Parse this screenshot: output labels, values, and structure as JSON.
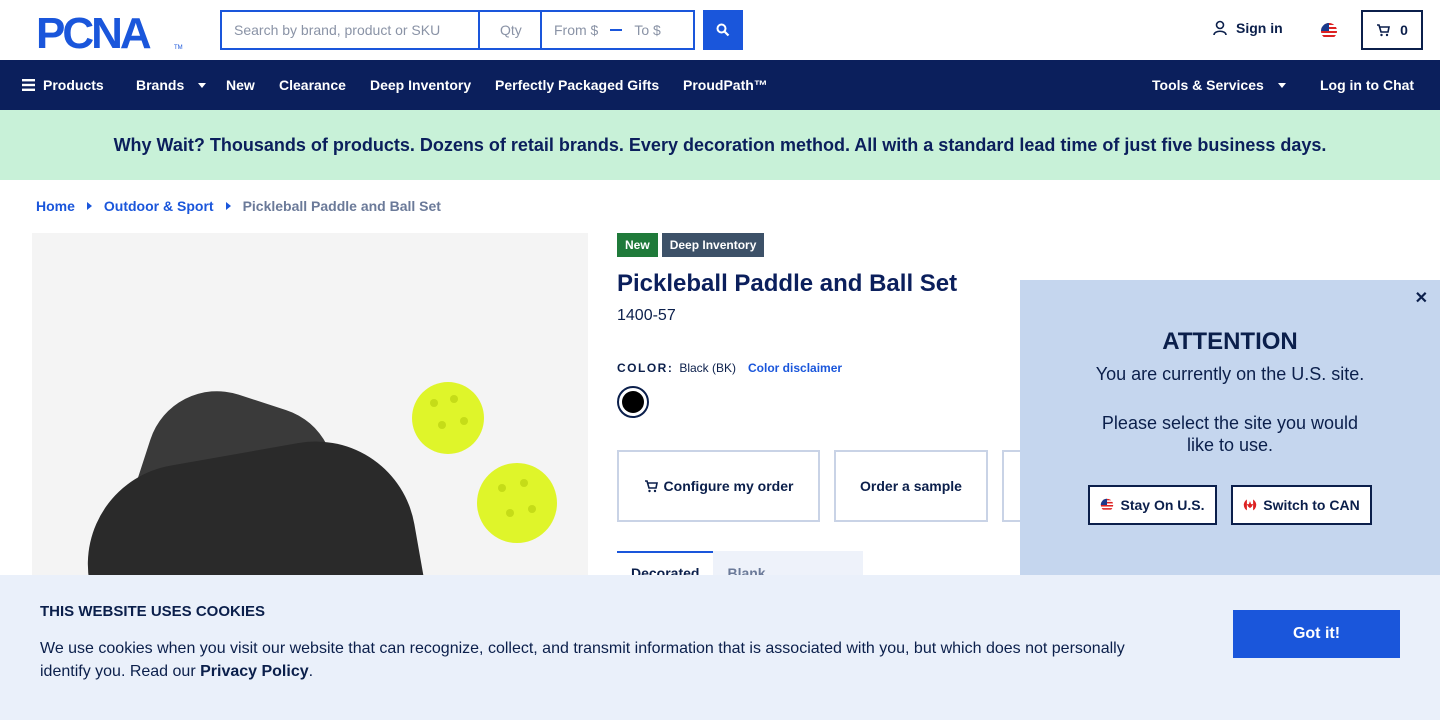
{
  "header": {
    "logo_text": "PCNA",
    "search_placeholder": "Search by brand, product or SKU",
    "qty_placeholder": "Qty",
    "from_placeholder": "From $",
    "to_placeholder": "To $",
    "signin_label": "Sign in",
    "cart_count": "0"
  },
  "nav": {
    "products": "Products",
    "brands": "Brands",
    "new": "New",
    "clearance": "Clearance",
    "deep_inventory": "Deep Inventory",
    "gifts": "Perfectly Packaged Gifts",
    "proudpath": "ProudPath™",
    "tools": "Tools & Services",
    "chat": "Log in to Chat"
  },
  "promo": "Why Wait? Thousands of products. Dozens of retail brands. Every decoration method. All with a standard lead time of just five business days.",
  "breadcrumb": [
    "Home",
    "Outdoor & Sport",
    "Pickleball Paddle and Ball Set"
  ],
  "product": {
    "badges": [
      "New",
      "Deep Inventory"
    ],
    "title": "Pickleball Paddle and Ball Set",
    "sku": "1400-57",
    "color_label": "COLOR:",
    "color_value": "Black (BK)",
    "color_disclaimer": "Color disclaimer",
    "swatch_color": "#000000",
    "actions": [
      "Configure my order",
      "Order a sample"
    ],
    "tabs": [
      "Decorated",
      "Blank"
    ]
  },
  "attention": {
    "title": "ATTENTION",
    "line1": "You are currently on the U.S. site.",
    "line2": "Please select the site you would like to use.",
    "stay": "Stay On U.S.",
    "switch": "Switch to CAN"
  },
  "cookie": {
    "title": "THIS WEBSITE USES COOKIES",
    "text": "We use cookies when you visit our website that can recognize, collect, and transmit information that is associated with you, but which does not personally identify you. Read our ",
    "link": "Privacy Policy",
    "end": ".",
    "button": "Got it!"
  },
  "colors": {
    "brand_navy": "#0b1f5c",
    "accent_blue": "#1a56db",
    "promo_bg": "#c8f1d8"
  }
}
